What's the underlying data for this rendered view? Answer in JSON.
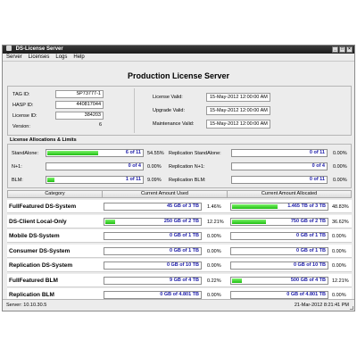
{
  "window": {
    "title": "DS-License Server",
    "controls": [
      "_",
      "□",
      "×"
    ]
  },
  "menu": [
    "Server",
    "Licenses",
    "Logs",
    "Help"
  ],
  "header": {
    "title": "Production License Server"
  },
  "info": {
    "left": [
      {
        "label": "TAG ID:",
        "value": "SP73777-1",
        "boxed": true
      },
      {
        "label": "HASP ID:",
        "value": "440817044",
        "boxed": true
      },
      {
        "label": "License ID:",
        "value": "384203",
        "boxed": true
      },
      {
        "label": "Version:",
        "value": "6",
        "boxed": false
      }
    ],
    "right": [
      {
        "label": "License Valid:",
        "value": "15-May-2012 12:00:00 AM"
      },
      {
        "label": "Upgrade Valid:",
        "value": "15-May-2012 12:00:00 AM"
      },
      {
        "label": "Maintenance Valid:",
        "value": "15-May-2012 12:00:00 AM"
      }
    ]
  },
  "allocations": {
    "heading": "License Allocations & Limits",
    "left": [
      {
        "label": "StandAlone:",
        "text": "6 of 11",
        "fill": 0.5455,
        "pct": "54.55%"
      },
      {
        "label": "N+1:",
        "text": "0 of 4",
        "fill": 0.0,
        "pct": "0.00%"
      },
      {
        "label": "BLM:",
        "text": "1 of 11",
        "fill": 0.0909,
        "pct": "9.09%"
      }
    ],
    "right": [
      {
        "label": "Replication StandAlone:",
        "text": "0 of 11",
        "fill": 0.0,
        "pct": "0.00%"
      },
      {
        "label": "Replication N+1:",
        "text": "0 of 4",
        "fill": 0.0,
        "pct": "0.00%"
      },
      {
        "label": "Replication BLM:",
        "text": "0 of 11",
        "fill": 0.0,
        "pct": "0.00%"
      }
    ]
  },
  "table": {
    "headers": [
      "Category",
      "Current Amount Used",
      "Current Amount Allocated"
    ],
    "rows": [
      {
        "category": "FullFeatured DS-System",
        "used": "45 GB of 3 TB",
        "used_fill": 0.0146,
        "used_pct": "1.46%",
        "alloc": "1.465 TB of 3 TB",
        "alloc_fill": 0.4883,
        "alloc_pct": "48.83%"
      },
      {
        "category": "DS-Client Local-Only",
        "used": "250 GB of 2 TB",
        "used_fill": 0.1221,
        "used_pct": "12.21%",
        "alloc": "750 GB of 2 TB",
        "alloc_fill": 0.3662,
        "alloc_pct": "36.62%"
      },
      {
        "category": "Mobile DS-System",
        "used": "0 GB of 1 TB",
        "used_fill": 0.0,
        "used_pct": "0.00%",
        "alloc": "0 GB of 1 TB",
        "alloc_fill": 0.0,
        "alloc_pct": "0.00%"
      },
      {
        "category": "Consumer DS-System",
        "used": "0 GB of 1 TB",
        "used_fill": 0.0,
        "used_pct": "0.00%",
        "alloc": "0 GB of 1 TB",
        "alloc_fill": 0.0,
        "alloc_pct": "0.00%"
      },
      {
        "category": "Replication DS-System",
        "used": "0 GB of 10 TB",
        "used_fill": 0.0,
        "used_pct": "0.00%",
        "alloc": "0 GB of 10 TB",
        "alloc_fill": 0.0,
        "alloc_pct": "0.00%"
      },
      {
        "category": "FullFeatured BLM",
        "used": "9 GB of 4 TB",
        "used_fill": 0.0022,
        "used_pct": "0.22%",
        "alloc": "500 GB of 4 TB",
        "alloc_fill": 0.1221,
        "alloc_pct": "12.21%"
      },
      {
        "category": "Replication BLM",
        "used": "0 GB of 4.801 TB",
        "used_fill": 0.0,
        "used_pct": "0.00%",
        "alloc": "0 GB of 4.801 TB",
        "alloc_fill": 0.0,
        "alloc_pct": "0.00%"
      }
    ]
  },
  "status": {
    "server": "Server: 10.10.30.5",
    "datetime": "21-Mar-2012 8:21:41 PM"
  },
  "colors": {
    "bar_fill": "#2ecb1f",
    "bar_text": "#1a1aa8",
    "titlebar": "#2a2a2a"
  }
}
